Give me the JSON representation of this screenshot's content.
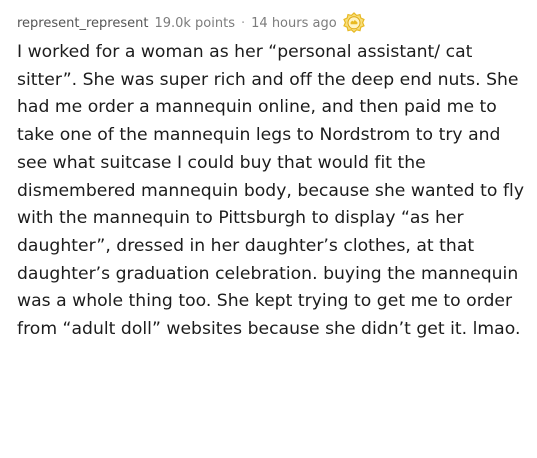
{
  "comment": {
    "username": "represent_represent",
    "points": "19.0k points",
    "separator": "·",
    "time": "14 hours ago",
    "award_icon": "helpful-award-icon",
    "body": "I worked for a woman as her “personal assistant/ cat sitter”. She was super rich and off the deep end nuts. She had me order a mannequin online, and then paid me to take one of the mannequin legs to Nordstrom to try and see what suitcase I could buy that would fit the dismembered mannequin body, because she wanted to fly with the mannequin to Pittsburgh to display “as her daughter”, dressed in her daughter’s clothes, at that daughter’s graduation celebration. buying the mannequin was a whole thing too. She kept trying to get me to order from “adult doll” websites because she didn’t get it. lmao."
  },
  "colors": {
    "award_gold": "#e8b923",
    "award_light": "#f7de7a",
    "text": "#1c1c1c",
    "meta": "#7c7c7c"
  }
}
